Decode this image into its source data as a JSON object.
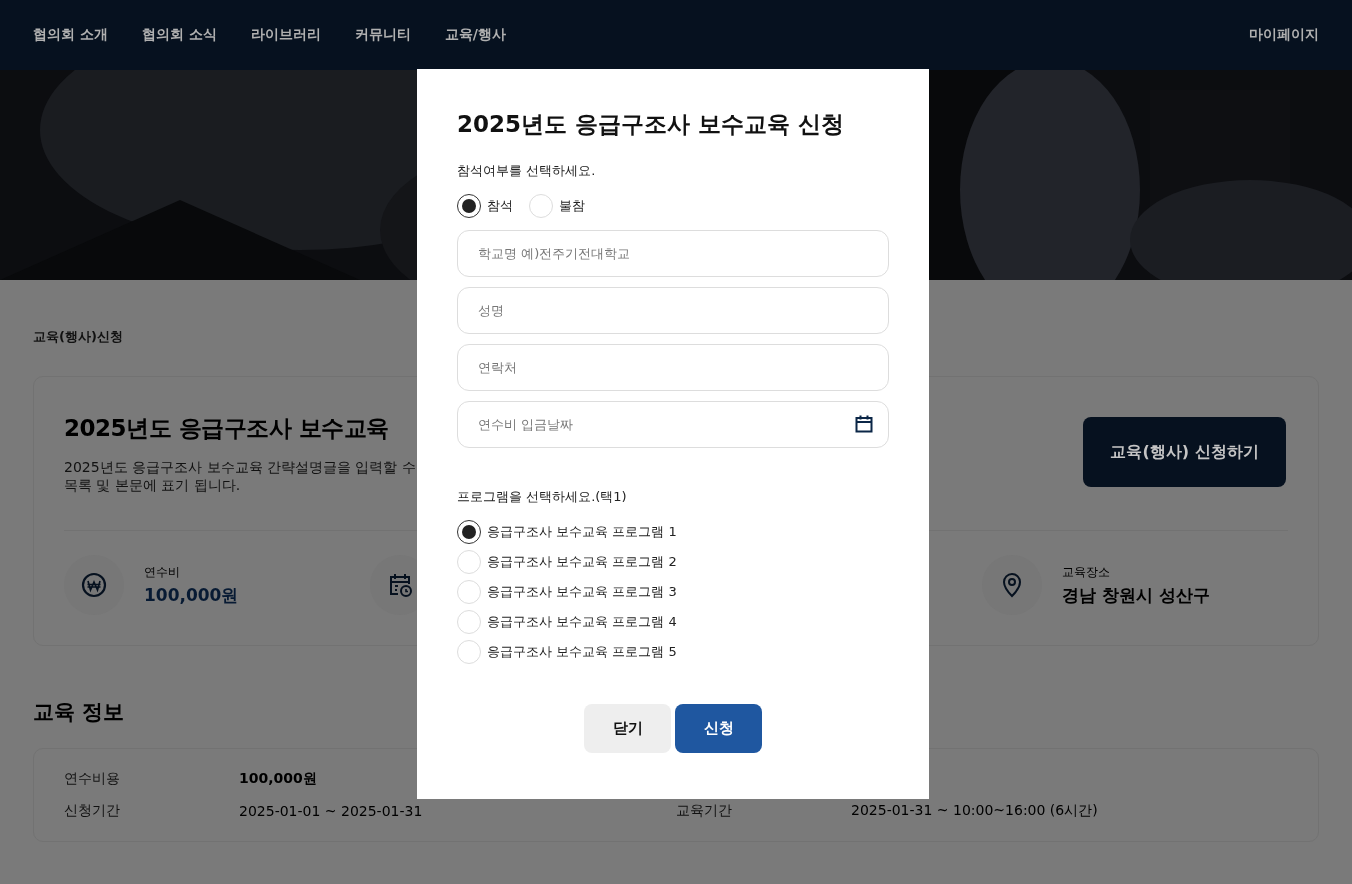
{
  "nav": {
    "links": [
      "협의회 소개",
      "협의회 소식",
      "라이브러리",
      "커뮤니티",
      "교육/행사"
    ],
    "mypage": "마이페이지"
  },
  "breadcrumb": "교육(행사)신청",
  "event": {
    "title": "2025년도 응급구조사 보수교육",
    "description": [
      "2025년도 응급구조사 보수교육 간략설명글을 입력할 수",
      "목록 및 본문에 표기 됩니다."
    ],
    "apply_button": "교육(행사) 신청하기",
    "info_items": [
      {
        "kind": "fee",
        "label": "연수비",
        "value": "100,000원"
      },
      {
        "kind": "schedule"
      },
      {
        "kind": "place",
        "label": "교육장소",
        "value": "경남 창원시 성산구"
      }
    ]
  },
  "section_title": "교육 정보",
  "details": {
    "left": [
      {
        "label": "연수비용",
        "value": "100,000원",
        "strong": true
      },
      {
        "label": "신청기간",
        "value": "2025-01-01 ~ 2025-01-31",
        "strong": false
      }
    ],
    "right": [
      {
        "label": "교육기간",
        "value": "2025-01-31 ~ 10:00~16:00 (6시간)",
        "strong": false
      }
    ]
  },
  "modal": {
    "title": "2025년도 응급구조사 보수교육 신청",
    "attendance_prompt": "참석여부를 선택하세요.",
    "attendance": [
      {
        "label": "참석",
        "selected": true
      },
      {
        "label": "불참",
        "selected": false
      }
    ],
    "fields": [
      {
        "kind": "text",
        "placeholder": "학교명 예)전주기전대학교"
      },
      {
        "kind": "text",
        "placeholder": "성명"
      },
      {
        "kind": "text",
        "placeholder": "연락처"
      },
      {
        "kind": "date",
        "placeholder": "연수비 입금날짜"
      }
    ],
    "program_prompt": "프로그램을 선택하세요.(택1)",
    "programs": [
      {
        "label": "응급구조사 보수교육 프로그램 1",
        "selected": true
      },
      {
        "label": "응급구조사 보수교육 프로그램 2",
        "selected": false
      },
      {
        "label": "응급구조사 보수교육 프로그램 3",
        "selected": false
      },
      {
        "label": "응급구조사 보수교육 프로그램 4",
        "selected": false
      },
      {
        "label": "응급구조사 보수교육 프로그램 5",
        "selected": false
      }
    ],
    "buttons": [
      {
        "kind": "secondary",
        "label": "닫기"
      },
      {
        "kind": "primary",
        "label": "신청"
      }
    ]
  }
}
